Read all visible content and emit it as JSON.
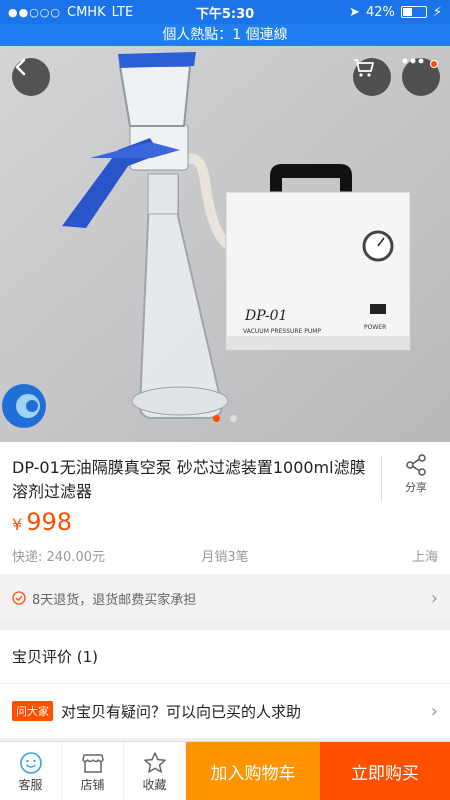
{
  "status_bar": {
    "signal": "●●○○○",
    "carrier": "CMHK",
    "network": "LTE",
    "time": "下午5:30",
    "battery_text": "42%",
    "battery_level": 0.42
  },
  "hotspot": {
    "text": "個人熱點：1 個連線"
  },
  "gallery": {
    "pump_label": "DP-01",
    "pump_sub": "VACUUM PRESSURE PUMP",
    "power_label": "POWER",
    "slide_count": 2,
    "active_slide": 0
  },
  "product": {
    "title": "DP-01无油隔膜真空泵 砂芯过滤装置1000ml滤膜溶剂过滤器",
    "share_label": "分享",
    "currency": "¥",
    "price": "998",
    "shipping": "快递: 240.00元",
    "monthly_sales": "月销3笔",
    "location": "上海"
  },
  "returns": {
    "text": "8天退货，退货邮费买家承担"
  },
  "reviews": {
    "label": "宝贝评价 (1)"
  },
  "ask": {
    "badge": "问大家",
    "text": "对宝贝有疑问？可以向已买的人求助"
  },
  "bottom_bar": {
    "service_label": "客服",
    "shop_label": "店铺",
    "favorite_label": "收藏",
    "add_cart_label": "加入购物车",
    "buy_now_label": "立即购买"
  },
  "colors": {
    "accent": "#ff5000",
    "cart": "#ff9402",
    "status_bar": "#1a73e8"
  }
}
